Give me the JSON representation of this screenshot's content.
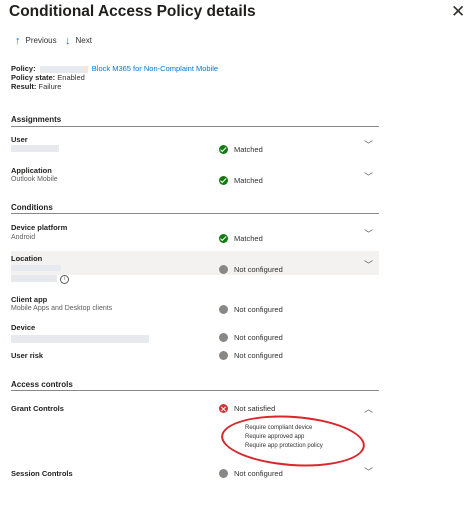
{
  "panel": {
    "title": "Conditional Access Policy details",
    "close_label": "✕"
  },
  "toolbar": {
    "previous_label": "Previous",
    "next_label": "Next"
  },
  "summary": {
    "policy_label": "Policy:",
    "policy_name": "Block M365 for Non-Complaint Mobile",
    "state_label": "Policy state:",
    "state_value": "Enabled",
    "result_label": "Result:",
    "result_value": "Failure"
  },
  "sections": {
    "assignments": "Assignments",
    "conditions": "Conditions",
    "access_controls": "Access controls"
  },
  "rows": {
    "user": {
      "label": "User",
      "status": "Matched"
    },
    "application": {
      "label": "Application",
      "value": "Outlook Mobile",
      "status": "Matched"
    },
    "device_platform": {
      "label": "Device platform",
      "value": "Android",
      "status": "Matched"
    },
    "location": {
      "label": "Location",
      "status": "Not configured"
    },
    "client_app": {
      "label": "Client app",
      "value": "Mobile Apps and Desktop clients",
      "status": "Not configured"
    },
    "device": {
      "label": "Device",
      "status": "Not configured"
    },
    "user_risk": {
      "label": "User risk",
      "status": "Not configured"
    },
    "grant_controls": {
      "label": "Grant Controls",
      "status": "Not satisfied",
      "items": [
        "Require compliant device",
        "Require approved app",
        "Require app protection policy"
      ]
    },
    "session_controls": {
      "label": "Session Controls",
      "status": "Not configured"
    }
  },
  "colors": {
    "matched": "#107c10",
    "not_configured": "#8a8886",
    "not_satisfied": "#d13438",
    "link": "#0078d4",
    "annotation": "#d9262b"
  }
}
